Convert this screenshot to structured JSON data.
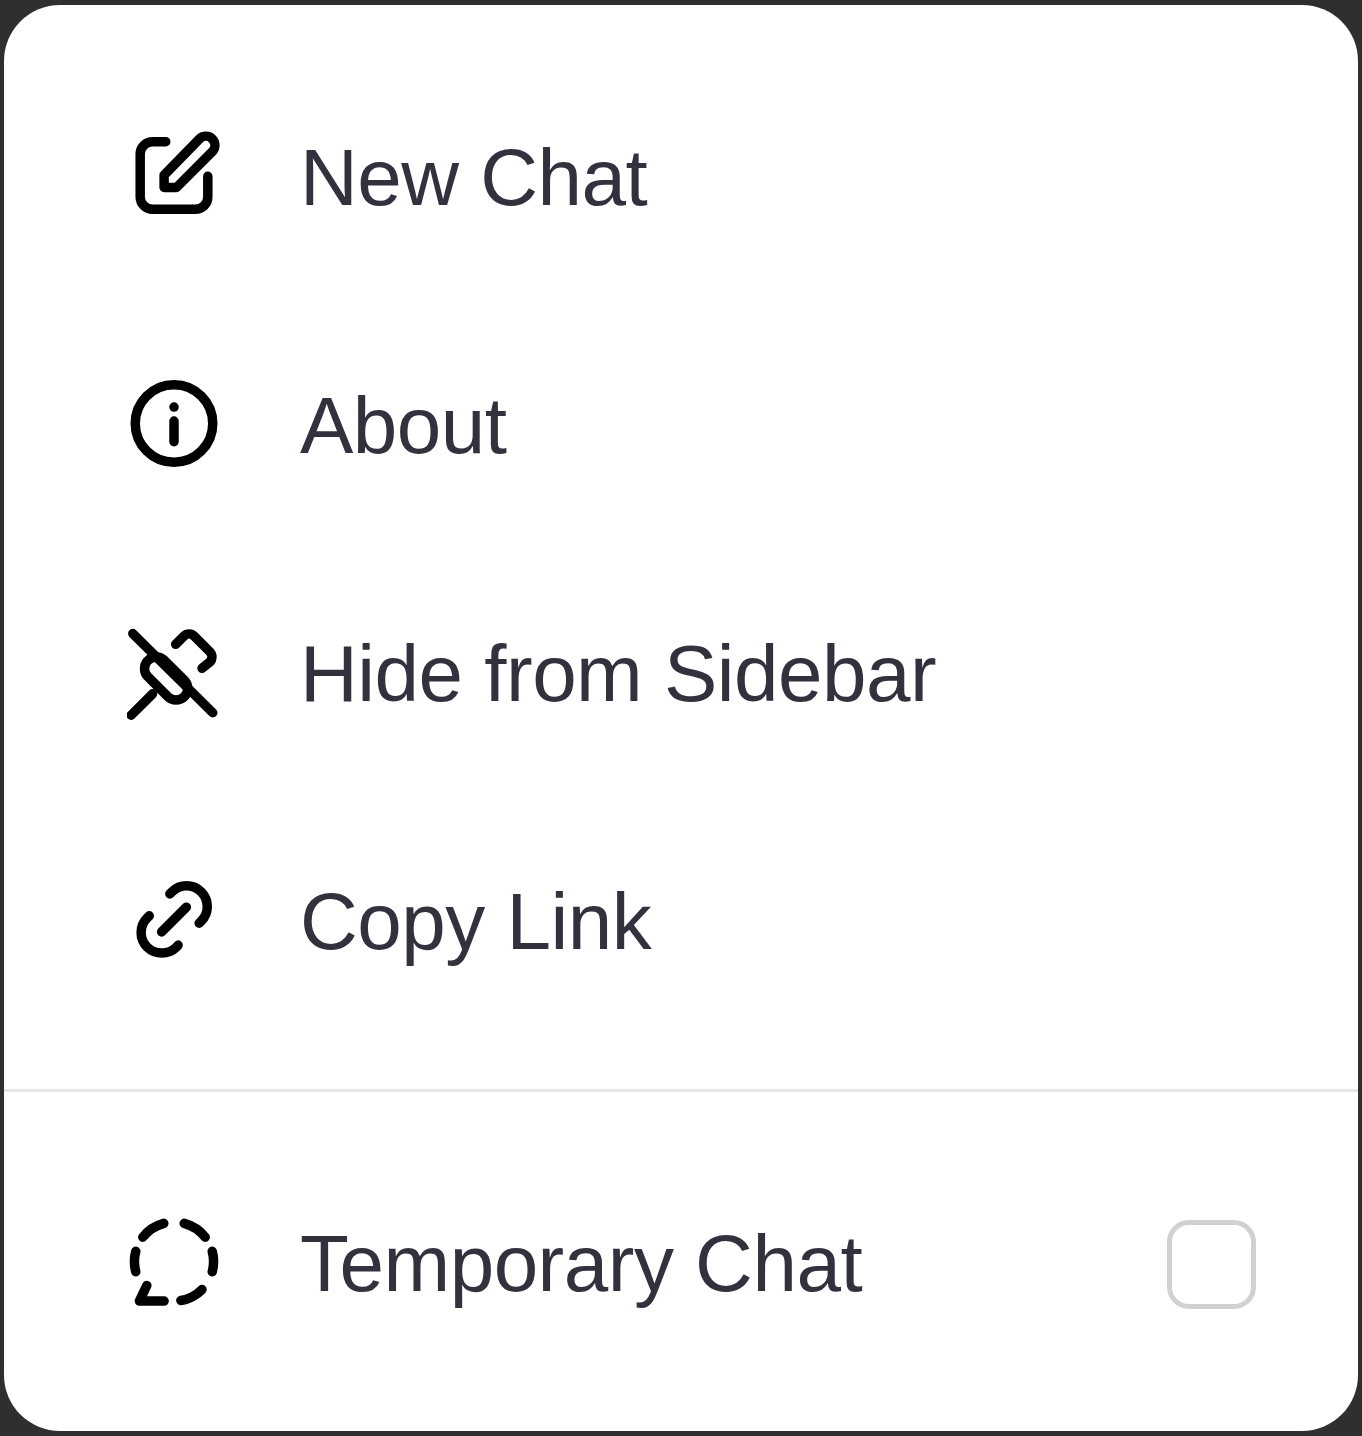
{
  "menu": {
    "items": [
      {
        "label": "New Chat"
      },
      {
        "label": "About"
      },
      {
        "label": "Hide from Sidebar"
      },
      {
        "label": "Copy Link"
      }
    ],
    "toggle_item": {
      "label": "Temporary Chat",
      "checked": false
    }
  }
}
